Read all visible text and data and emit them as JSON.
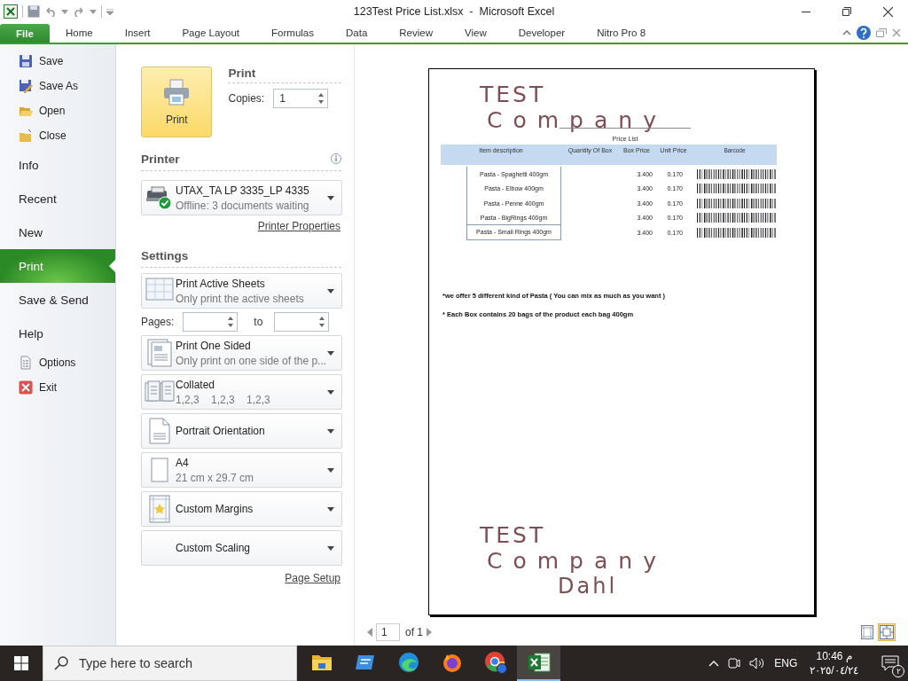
{
  "window": {
    "title": "123Test Price List.xlsx  -  Microsoft Excel"
  },
  "ribbon_tabs": [
    {
      "label": "File",
      "selected": true
    },
    {
      "label": "Home",
      "selected": false
    },
    {
      "label": "Insert",
      "selected": false
    },
    {
      "label": "Page Layout",
      "selected": false
    },
    {
      "label": "Formulas",
      "selected": false
    },
    {
      "label": "Data",
      "selected": false
    },
    {
      "label": "Review",
      "selected": false
    },
    {
      "label": "View",
      "selected": false
    },
    {
      "label": "Developer",
      "selected": false
    },
    {
      "label": "Nitro Pro 8",
      "selected": false
    }
  ],
  "backstage_nav": [
    {
      "label": "Save",
      "kind": "command",
      "selected": false
    },
    {
      "label": "Save As",
      "kind": "command",
      "selected": false
    },
    {
      "label": "Open",
      "kind": "command",
      "selected": false
    },
    {
      "label": "Close",
      "kind": "command",
      "selected": false
    },
    {
      "label": "Info",
      "kind": "page",
      "selected": false
    },
    {
      "label": "Recent",
      "kind": "page",
      "selected": false
    },
    {
      "label": "New",
      "kind": "page",
      "selected": false
    },
    {
      "label": "Print",
      "kind": "page",
      "selected": true
    },
    {
      "label": "Save & Send",
      "kind": "page",
      "selected": false
    },
    {
      "label": "Help",
      "kind": "page",
      "selected": false
    },
    {
      "label": "Options",
      "kind": "command",
      "selected": false
    },
    {
      "label": "Exit",
      "kind": "command",
      "selected": false
    }
  ],
  "print": {
    "button": "Print",
    "heading": "Print",
    "copies_label": "Copies:",
    "copies": "1"
  },
  "printer": {
    "heading": "Printer",
    "name": "UTAX_TA LP 3335_LP 4335",
    "status": "Offline: 3 documents waiting",
    "properties_link": "Printer Properties"
  },
  "settings": {
    "heading": "Settings",
    "items": [
      {
        "kind": "dropdown",
        "title": "Print Active Sheets",
        "subtitle": "Only print the active sheets"
      },
      {
        "kind": "pages",
        "label": "Pages:",
        "to_label": "to"
      },
      {
        "kind": "dropdown",
        "title": "Print One Sided",
        "subtitle": "Only print on one side of the p..."
      },
      {
        "kind": "dropdown",
        "title": "Collated",
        "subtitle": "1,2,3    1,2,3    1,2,3"
      },
      {
        "kind": "dropdown",
        "title": "Portrait Orientation"
      },
      {
        "kind": "dropdown",
        "title": "A4",
        "subtitle": "21 cm x 29.7 cm"
      },
      {
        "kind": "dropdown",
        "title": "Custom Margins"
      },
      {
        "kind": "dropdown",
        "title": "Custom Scaling"
      }
    ],
    "page_setup_link": "Page Setup"
  },
  "preview": {
    "page": {
      "handwriting_top": [
        "TEST",
        "Company"
      ],
      "table_title": "Price List",
      "columns": [
        "Item description",
        "Quantity Of Box",
        "Box Price",
        "Unit Price",
        "Barcode"
      ],
      "rows": [
        {
          "item": "Pasta - Spaghetti 400gm",
          "box_price": "3.400",
          "unit_price": "0.170"
        },
        {
          "item": "Pasta - Elbow 400gm",
          "box_price": "3.400",
          "unit_price": "0.170"
        },
        {
          "item": "Pasta - Penne 400gm",
          "box_price": "3.400",
          "unit_price": "0.170"
        },
        {
          "item": "Pasta - BigRings 400gm",
          "box_price": "3.400",
          "unit_price": "0.170"
        },
        {
          "item": "Pasta - Small Rings 400gm",
          "box_price": "3.400",
          "unit_price": "0.170"
        }
      ],
      "notes": [
        "*we offer 5 different kind of Pasta ( You can mix as much as you want )",
        "* Each Box contains 20 bags of the product each bag 400gm"
      ],
      "handwriting_bottom": [
        "TEST",
        "Company",
        "Dahl"
      ]
    },
    "page_number": "1",
    "page_total": "of 1"
  },
  "taskbar": {
    "search_placeholder": "Type here to search",
    "apps": [
      {
        "selected": false
      },
      {
        "selected": false
      },
      {
        "selected": false
      },
      {
        "selected": false
      },
      {
        "selected": false
      },
      {
        "selected": true
      }
    ],
    "language": "ENG",
    "time": "10:46 م",
    "date": "٢٠٢٥/٠٤/٢٤",
    "notification_count": "٢"
  }
}
